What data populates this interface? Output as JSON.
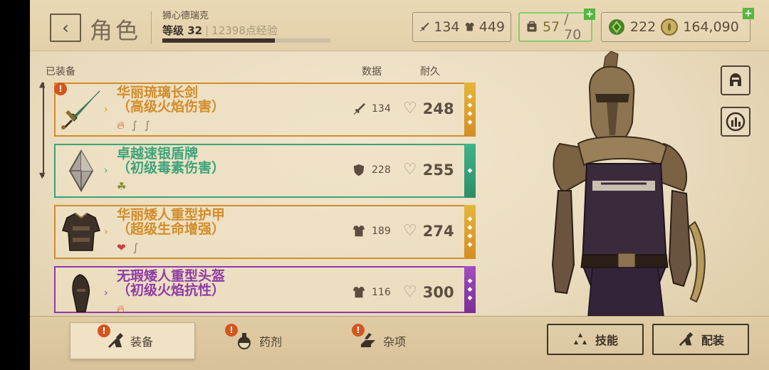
{
  "header": {
    "back_icon": "chevron-left-icon",
    "title": "角色",
    "character_name": "狮心德瑞克",
    "level_label": "等级 32",
    "xp_label": "12398点经验",
    "xp_progress": 0.67,
    "attack": "134",
    "armor": "449",
    "bag_current": "57",
    "bag_max": "/ 70",
    "gems": "222",
    "gold": "164,090"
  },
  "list": {
    "equipped_label": "已装备",
    "col_data": "数据",
    "col_durability": "耐久",
    "items": [
      {
        "name": "华丽琉璃长剑",
        "sub": "（高级火焰伤害）",
        "stat": "134",
        "stat_icon": "sword-icon",
        "durability": "248",
        "rarity": "legendary",
        "warning": "!"
      },
      {
        "name": "卓越速银盾牌",
        "sub": "（初级毒素伤害）",
        "stat": "228",
        "stat_icon": "shield-icon",
        "durability": "255",
        "rarity": "uncommon"
      },
      {
        "name": "华丽矮人重型护甲",
        "sub": "（超级生命增强）",
        "stat": "189",
        "stat_icon": "armor-icon",
        "durability": "274",
        "rarity": "legendary"
      },
      {
        "name": "无瑕矮人重型头盔",
        "sub": "（初级火焰抗性）",
        "stat": "116",
        "stat_icon": "armor-icon",
        "durability": "300",
        "rarity": "epic"
      }
    ]
  },
  "tabs": {
    "equipment": "装备",
    "potions": "药剂",
    "misc": "杂项",
    "warning": "!"
  },
  "actions": {
    "skills": "技能",
    "loadout": "配装"
  },
  "colors": {
    "legendary": "#d28c2a",
    "uncommon": "#3ba47a",
    "epic": "#8f3aa7",
    "bag_highlight": "#8acb6b"
  }
}
